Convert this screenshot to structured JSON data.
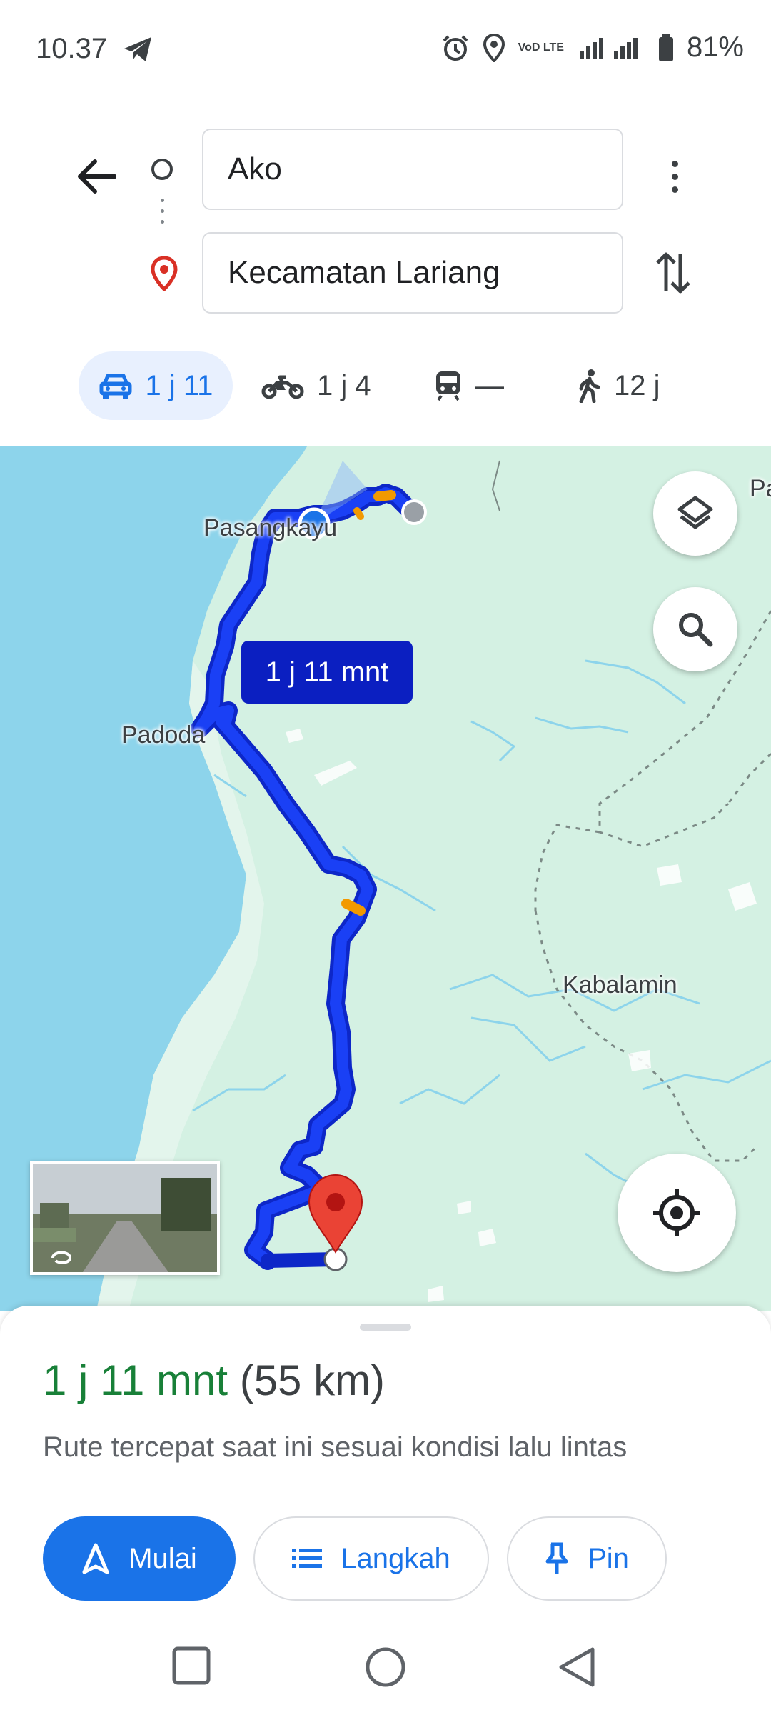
{
  "status_bar": {
    "time": "10.37",
    "battery": "81%",
    "volte_label": "VoD LTE",
    "lte_label": "LTE"
  },
  "directions": {
    "origin": "Ako",
    "destination": "Kecamatan Lariang"
  },
  "travel_modes": [
    {
      "icon": "car-icon",
      "label": "1 j 11",
      "selected": true
    },
    {
      "icon": "motorcycle-icon",
      "label": "1 j 4"
    },
    {
      "icon": "transit-icon",
      "label": "—"
    },
    {
      "icon": "walk-icon",
      "label": "12 j"
    }
  ],
  "map": {
    "labels": {
      "pasangkayu": "Pasangkayu",
      "padoda": "Padoda",
      "kabalamin": "Kabalamin",
      "edge": "Pa"
    },
    "route_eta": "1 j 11 mnt",
    "colors": {
      "route": "#1a33f0",
      "water": "#8dd4eb",
      "land": "#d4f1e3",
      "traffic": "#f29900"
    }
  },
  "summary": {
    "duration": "1 j 11 mnt",
    "distance": "(55 km)",
    "description": "Rute tercepat saat ini sesuai kondisi lalu lintas"
  },
  "actions": {
    "start": "Mulai",
    "steps": "Langkah",
    "pin": "Pin"
  }
}
